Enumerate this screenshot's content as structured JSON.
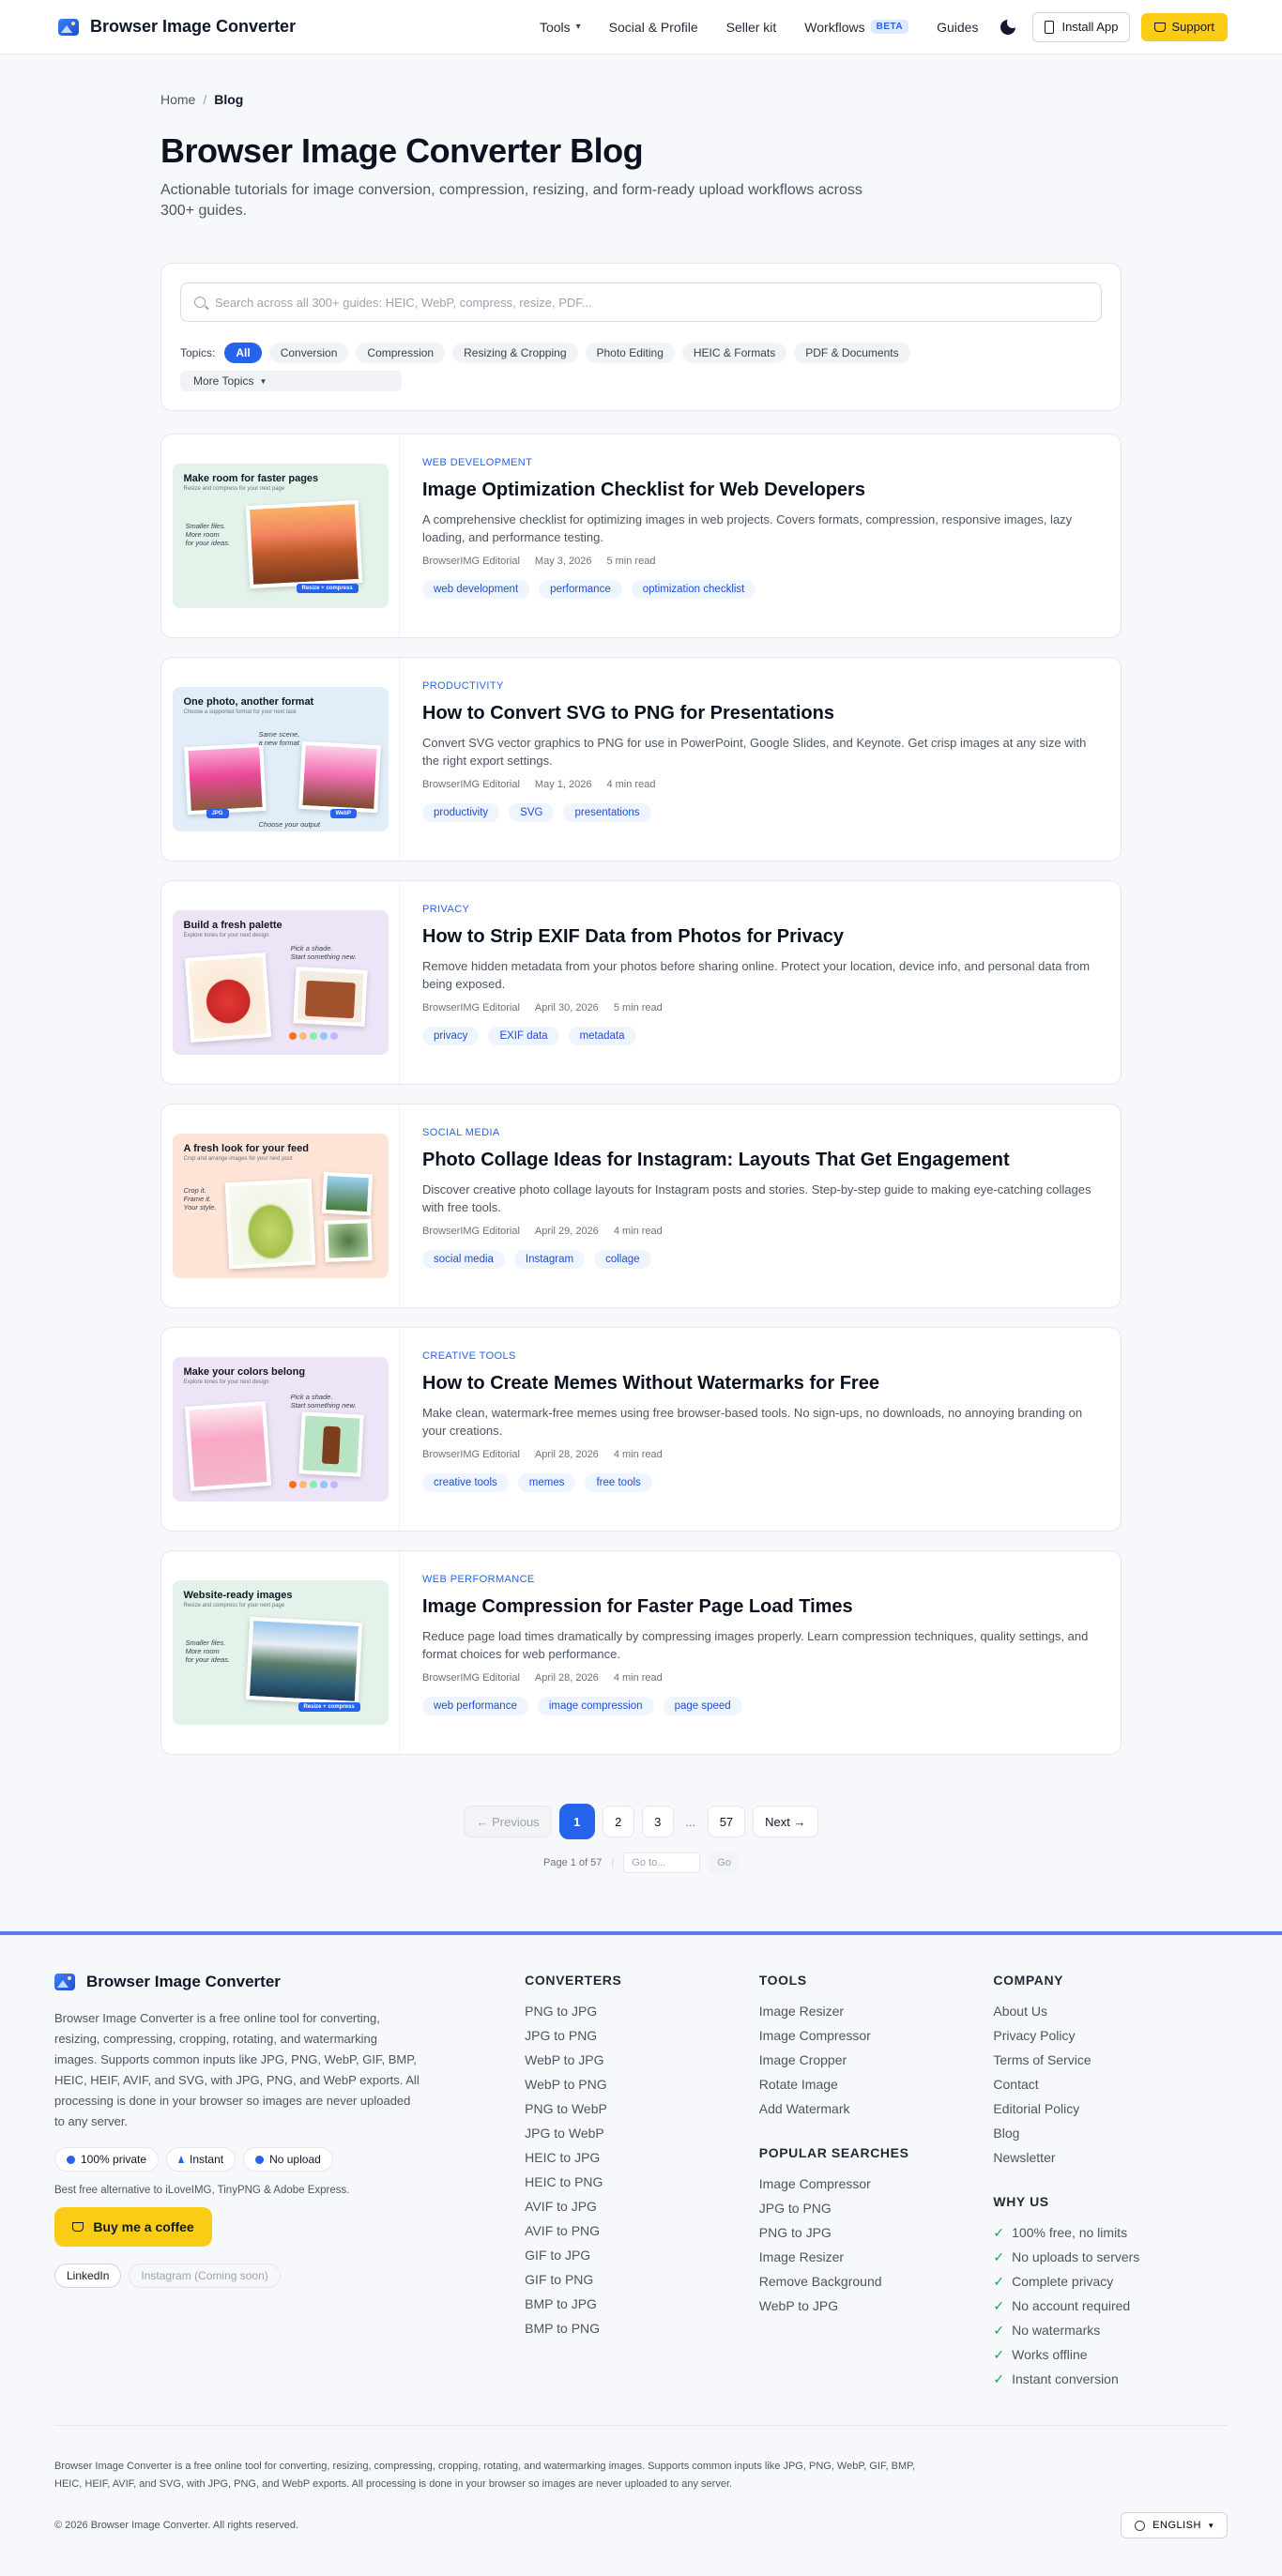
{
  "header": {
    "brand": "Browser Image Converter",
    "nav": [
      {
        "label": "Tools"
      },
      {
        "label": "Social & Profile"
      },
      {
        "label": "Seller kit"
      },
      {
        "label": "Workflows",
        "badge": "BETA"
      },
      {
        "label": "Guides"
      }
    ],
    "install_label": "Install App",
    "support_label": "Support"
  },
  "breadcrumb": {
    "home": "Home",
    "current": "Blog"
  },
  "page": {
    "title": "Browser Image Converter Blog",
    "subtitle": "Actionable tutorials for image conversion, compression, resizing, and form-ready upload workflows across 300+ guides."
  },
  "search": {
    "placeholder": "Search across all 300+ guides: HEIC, WebP, compress, resize, PDF...",
    "topics_label": "Topics:",
    "topics": [
      "All",
      "Conversion",
      "Compression",
      "Resizing & Cropping",
      "Photo Editing",
      "HEIC & Formats",
      "PDF & Documents"
    ],
    "more_topics": "More Topics"
  },
  "posts": [
    {
      "category": "Web Development",
      "title": "Image Optimization Checklist for Web Developers",
      "description": "A comprehensive checklist for optimizing images in web projects. Covers formats, compression, responsive images, lazy loading, and performance testing.",
      "author": "BrowserIMG Editorial",
      "date": "May 3, 2026",
      "read": "5 min read",
      "tags": [
        "web development",
        "performance",
        "optimization checklist"
      ],
      "thumb": {
        "title": "Make room for faster pages",
        "sub": "Resize and compress for your next page",
        "note": "Smaller files.\nMore room\nfor your ideas.",
        "badge": "Resize + compress",
        "bg": "#e3f3ea"
      }
    },
    {
      "category": "Productivity",
      "title": "How to Convert SVG to PNG for Presentations",
      "description": "Convert SVG vector graphics to PNG for use in PowerPoint, Google Slides, and Keynote. Get crisp images at any size with the right export settings.",
      "author": "BrowserIMG Editorial",
      "date": "May 1, 2026",
      "read": "4 min read",
      "tags": [
        "productivity",
        "SVG",
        "presentations"
      ],
      "thumb": {
        "title": "One photo, another format",
        "sub": "Choose a supported format for your next task",
        "note": "Same scene,\na new format",
        "badge": "JPG",
        "badge2": "WebP",
        "caption": "Choose your output",
        "bg": "#e1edf9"
      }
    },
    {
      "category": "Privacy",
      "title": "How to Strip EXIF Data from Photos for Privacy",
      "description": "Remove hidden metadata from your photos before sharing online. Protect your location, device info, and personal data from being exposed.",
      "author": "BrowserIMG Editorial",
      "date": "April 30, 2026",
      "read": "5 min read",
      "tags": [
        "privacy",
        "EXIF data",
        "metadata"
      ],
      "thumb": {
        "title": "Build a fresh palette",
        "sub": "Explore tones for your next design",
        "note": "Pick a shade.\nStart something new.",
        "bg": "#ede4f7"
      }
    },
    {
      "category": "Social Media",
      "title": "Photo Collage Ideas for Instagram: Layouts That Get Engagement",
      "description": "Discover creative photo collage layouts for Instagram posts and stories. Step-by-step guide to making eye-catching collages with free tools.",
      "author": "BrowserIMG Editorial",
      "date": "April 29, 2026",
      "read": "4 min read",
      "tags": [
        "social media",
        "Instagram",
        "collage"
      ],
      "thumb": {
        "title": "A fresh look for your feed",
        "sub": "Crop and arrange images for your next post",
        "note": "Crop it.\nFrame it.\nYour style.",
        "bg": "#fde4d6"
      }
    },
    {
      "category": "Creative Tools",
      "title": "How to Create Memes Without Watermarks for Free",
      "description": "Make clean, watermark-free memes using free browser-based tools. No sign-ups, no downloads, no annoying branding on your creations.",
      "author": "BrowserIMG Editorial",
      "date": "April 28, 2026",
      "read": "4 min read",
      "tags": [
        "creative tools",
        "memes",
        "free tools"
      ],
      "thumb": {
        "title": "Make your colors belong",
        "sub": "Explore tones for your next design",
        "note": "Pick a shade.\nStart something new.",
        "bg": "#ede4f7"
      }
    },
    {
      "category": "Web Performance",
      "title": "Image Compression for Faster Page Load Times",
      "description": "Reduce page load times dramatically by compressing images properly. Learn compression techniques, quality settings, and format choices for web performance.",
      "author": "BrowserIMG Editorial",
      "date": "April 28, 2026",
      "read": "4 min read",
      "tags": [
        "web performance",
        "image compression",
        "page speed"
      ],
      "thumb": {
        "title": "Website-ready images",
        "sub": "Resize and compress for your next page",
        "note": "Smaller files.\nMore room\nfor your ideas.",
        "badge": "Resize + compress",
        "bg": "#e3f3ea"
      }
    }
  ],
  "pagination": {
    "previous": "← Previous",
    "pages": [
      "1",
      "2",
      "3",
      "...",
      "57"
    ],
    "next": "Next →",
    "info": "Page 1 of 57",
    "goto_placeholder": "Go to...",
    "go": "Go"
  },
  "footer": {
    "brand": "Browser Image Converter",
    "description": "Browser Image Converter is a free online tool for converting, resizing, compressing, cropping, rotating, and watermarking images. Supports common inputs like JPG, PNG, WebP, GIF, BMP, HEIC, HEIF, AVIF, and SVG, with JPG, PNG, and WebP exports. All processing is done in your browser so images are never uploaded to any server.",
    "trust": [
      "100% private",
      "Instant",
      "No upload"
    ],
    "alternative": "Best free alternative to iLoveIMG, TinyPNG & Adobe Express.",
    "coffee": "Buy me a coffee",
    "socials": [
      "LinkedIn",
      "Instagram (Coming soon)"
    ],
    "converters_title": "CONVERTERS",
    "converters": [
      "PNG to JPG",
      "JPG to PNG",
      "WebP to JPG",
      "WebP to PNG",
      "PNG to WebP",
      "JPG to WebP",
      "HEIC to JPG",
      "HEIC to PNG",
      "AVIF to JPG",
      "AVIF to PNG",
      "GIF to JPG",
      "GIF to PNG",
      "BMP to JPG",
      "BMP to PNG"
    ],
    "tools_title": "TOOLS",
    "tools": [
      "Image Resizer",
      "Image Compressor",
      "Image Cropper",
      "Rotate Image",
      "Add Watermark"
    ],
    "popular_title": "POPULAR SEARCHES",
    "popular": [
      "Image Compressor",
      "JPG to PNG",
      "PNG to JPG",
      "Image Resizer",
      "Remove Background",
      "WebP to JPG"
    ],
    "company_title": "COMPANY",
    "company": [
      "About Us",
      "Privacy Policy",
      "Terms of Service",
      "Contact",
      "Editorial Policy",
      "Blog",
      "Newsletter"
    ],
    "why_title": "WHY US",
    "why": [
      "100% free, no limits",
      "No uploads to servers",
      "Complete privacy",
      "No account required",
      "No watermarks",
      "Works offline",
      "Instant conversion"
    ],
    "legal": "Browser Image Converter is a free online tool for converting, resizing, compressing, cropping, rotating, and watermarking images. Supports common inputs like JPG, PNG, WebP, GIF, BMP, HEIC, HEIF, AVIF, and SVG, with JPG, PNG, and WebP exports. All processing is done in your browser so images are never uploaded to any server.",
    "copyright": "© 2026 Browser Image Converter. All rights reserved.",
    "language": "ENGLISH"
  }
}
